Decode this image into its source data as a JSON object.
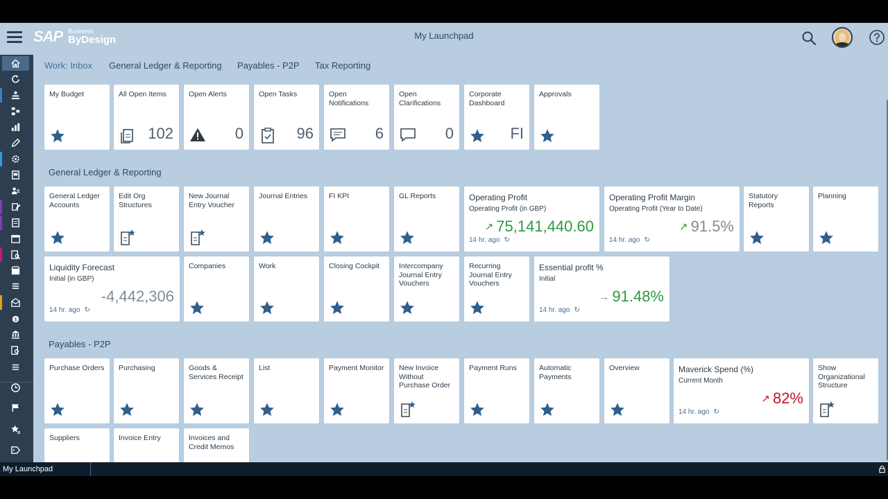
{
  "header": {
    "logo_main": "SAP",
    "logo_top": "Business",
    "logo_bottom": "ByDesign",
    "title": "My Launchpad"
  },
  "tabs": [
    {
      "label": "Work: Inbox"
    },
    {
      "label": "General Ledger & Reporting"
    },
    {
      "label": "Payables - P2P"
    },
    {
      "label": "Tax Reporting"
    }
  ],
  "sections": {
    "gl": "General Ledger & Reporting",
    "payables": "Payables - P2P"
  },
  "tiles": {
    "my_budget": {
      "title": "My Budget"
    },
    "all_open_items": {
      "title": "All Open Items",
      "count": "102"
    },
    "open_alerts": {
      "title": "Open Alerts",
      "count": "0"
    },
    "open_tasks": {
      "title": "Open Tasks",
      "count": "96"
    },
    "open_notifications": {
      "title": "Open Notifications",
      "count": "6"
    },
    "open_clarifications": {
      "title": "Open Clarifications",
      "count": "0"
    },
    "corporate_dashboard": {
      "title": "Corporate Dashboard",
      "count": "FI"
    },
    "approvals": {
      "title": "Approvals"
    },
    "gl_accounts": {
      "title": "General Ledger Accounts"
    },
    "edit_org": {
      "title": "Edit Org Structures"
    },
    "new_journal": {
      "title": "New Journal Entry Voucher"
    },
    "journal_entries": {
      "title": "Journal Entries"
    },
    "fi_kpi": {
      "title": "FI KPI"
    },
    "gl_reports": {
      "title": "GL Reports"
    },
    "operating_profit": {
      "title": "Operating Profit",
      "subtitle": "Operating Profit (in GBP)",
      "value": "75,141,440.60",
      "age": "14 hr. ago"
    },
    "operating_margin": {
      "title": "Operating Profit Margin",
      "subtitle": "Operating Profit (Year to Date)",
      "value": "91.5%",
      "age": "14 hr. ago"
    },
    "statutory": {
      "title": "Statutory Reports"
    },
    "planning": {
      "title": "Planning"
    },
    "liquidity": {
      "title": "Liquidity Forecast",
      "subtitle": "Initial (in GBP)",
      "value": "-4,442,306",
      "age": "14 hr. ago"
    },
    "companies": {
      "title": "Companies"
    },
    "work": {
      "title": "Work"
    },
    "closing_cockpit": {
      "title": "Closing Cockpit"
    },
    "intercompany": {
      "title": "Intercompany Journal Entry Vouchers"
    },
    "recurring": {
      "title": "Recurring Journal Entry Vouchers"
    },
    "essential_profit": {
      "title": "Essential profit %",
      "subtitle": "Initial",
      "value": "91.48%",
      "age": "14 hr. ago"
    },
    "purchase_orders": {
      "title": "Purchase Orders"
    },
    "purchasing": {
      "title": "Purchasing"
    },
    "goods_receipt": {
      "title": "Goods & Services Receipt"
    },
    "list": {
      "title": "List"
    },
    "payment_monitor": {
      "title": "Payment Monitor"
    },
    "new_invoice": {
      "title": "New Invoice Without Purchase Order"
    },
    "payment_runs": {
      "title": "Payment Runs"
    },
    "automatic_payments": {
      "title": "Automatic Payments"
    },
    "overview": {
      "title": "Overview"
    },
    "maverick": {
      "title": "Maverick Spend (%)",
      "subtitle": "Current Month",
      "value": "82%",
      "age": "14 hr. ago"
    },
    "show_org": {
      "title": "Show Organizational Structure"
    },
    "suppliers": {
      "title": "Suppliers"
    },
    "invoice_entry": {
      "title": "Invoice Entry"
    },
    "invoices_credit": {
      "title": "Invoices and Credit Memos"
    }
  },
  "colors": {
    "star": "#2f5f8a",
    "kpi_good": "#2b9a3f",
    "kpi_neutral": "#7f8b96",
    "kpi_bad": "#c8102e"
  },
  "taskbar": {
    "label": "My Launchpad"
  }
}
